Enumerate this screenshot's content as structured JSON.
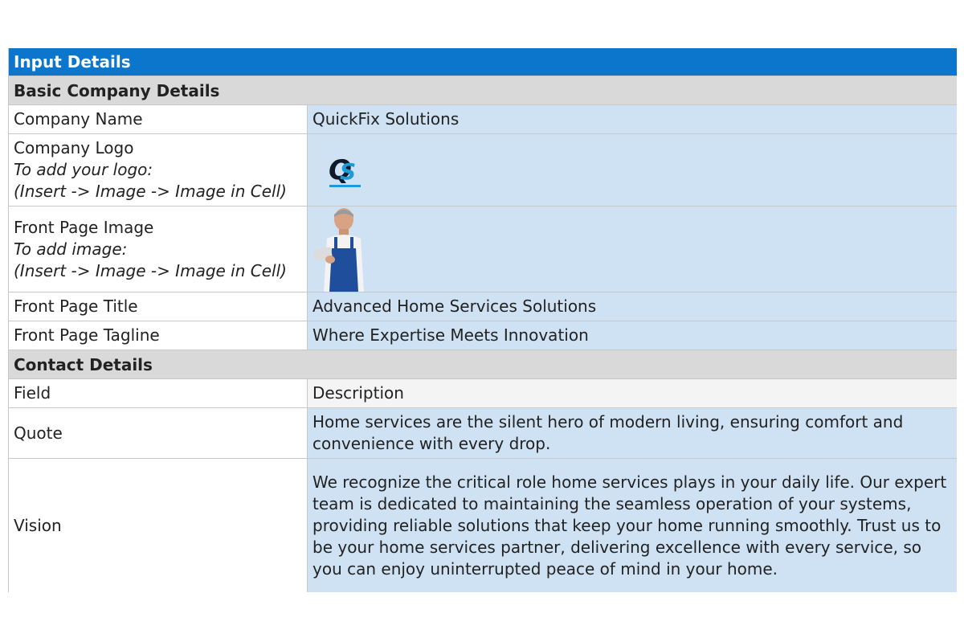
{
  "header": {
    "title": "Input Details"
  },
  "sections": {
    "basic": "Basic Company Details",
    "contact": "Contact Details"
  },
  "rows": {
    "company_name": {
      "label": "Company Name",
      "value": "QuickFix Solutions"
    },
    "company_logo": {
      "label": "Company Logo",
      "hint1": "To add your logo:",
      "hint2": "(Insert -> Image -> Image in Cell)",
      "logo_text": "QS"
    },
    "front_image": {
      "label": "Front Page Image",
      "hint1": "To add image:",
      "hint2": "(Insert -> Image -> Image in Cell)"
    },
    "front_title": {
      "label": "Front Page Title",
      "value": "Advanced Home Services Solutions"
    },
    "front_tagline": {
      "label": "Front Page Tagline",
      "value": "Where Expertise Meets Innovation"
    }
  },
  "contact": {
    "columns": {
      "field": "Field",
      "description": "Description"
    },
    "quote": {
      "label": "Quote",
      "value": "Home services are the silent hero of modern living, ensuring comfort and convenience with every drop."
    },
    "vision": {
      "label": "Vision",
      "value": "We recognize the critical role home services plays in your daily life. Our expert team is dedicated to maintaining the seamless operation of your systems, providing reliable solutions that keep your home running smoothly. Trust us to be your home services partner, delivering excellence with every service, so you can enjoy uninterrupted peace of mind in your home."
    }
  },
  "colors": {
    "header_blue": "#0b76cc",
    "section_gray": "#d9d9d9",
    "input_blue": "#cfe2f3"
  }
}
